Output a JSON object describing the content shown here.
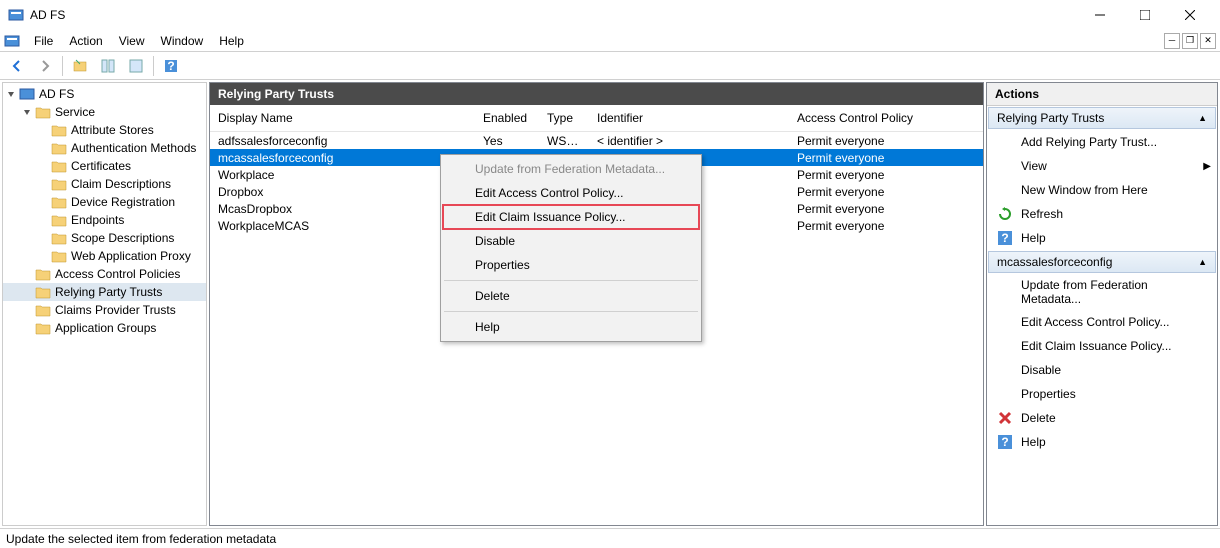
{
  "window": {
    "title": "AD FS"
  },
  "menubar": [
    "File",
    "Action",
    "View",
    "Window",
    "Help"
  ],
  "tree": {
    "root": "AD FS",
    "service": "Service",
    "service_children": [
      "Attribute Stores",
      "Authentication Methods",
      "Certificates",
      "Claim Descriptions",
      "Device Registration",
      "Endpoints",
      "Scope Descriptions",
      "Web Application Proxy"
    ],
    "top_children": [
      "Access Control Policies",
      "Relying Party Trusts",
      "Claims Provider Trusts",
      "Application Groups"
    ],
    "selected": "Relying Party Trusts"
  },
  "center": {
    "title": "Relying Party Trusts",
    "columns": {
      "name": "Display Name",
      "enabled": "Enabled",
      "type": "Type",
      "id": "Identifier",
      "acp": "Access Control Policy"
    },
    "rows": [
      {
        "name": "adfssalesforceconfig",
        "enabled": "Yes",
        "type": "WS-T...",
        "id": "< identifier >",
        "acp": "Permit everyone",
        "sel": false
      },
      {
        "name": "mcassalesforceconfig",
        "enabled": "",
        "type": "",
        "id": "",
        "acp": "Permit everyone",
        "sel": true
      },
      {
        "name": "Workplace",
        "enabled": "",
        "type": "",
        "id": "",
        "acp": "Permit everyone",
        "sel": false
      },
      {
        "name": "Dropbox",
        "enabled": "",
        "type": "",
        "id": "",
        "acp": "Permit everyone",
        "sel": false
      },
      {
        "name": "McasDropbox",
        "enabled": "",
        "type": "",
        "id": "",
        "acp": "Permit everyone",
        "sel": false
      },
      {
        "name": "WorkplaceMCAS",
        "enabled": "",
        "type": "",
        "id": "",
        "acp": "Permit everyone",
        "sel": false
      }
    ]
  },
  "contextMenu": [
    {
      "label": "Update from Federation Metadata...",
      "disabled": true
    },
    {
      "label": "Edit Access Control Policy...",
      "disabled": false
    },
    {
      "label": "Edit Claim Issuance Policy...",
      "disabled": false,
      "highlight": true
    },
    {
      "label": "Disable",
      "disabled": false
    },
    {
      "label": "Properties",
      "disabled": false
    },
    {
      "sep": true
    },
    {
      "label": "Delete",
      "disabled": false
    },
    {
      "sep": true
    },
    {
      "label": "Help",
      "disabled": false
    }
  ],
  "actions": {
    "header": "Actions",
    "group1": {
      "title": "Relying Party Trusts",
      "items": [
        {
          "label": "Add Relying Party Trust...",
          "icon": "none"
        },
        {
          "label": "View",
          "icon": "none",
          "sub": true
        },
        {
          "label": "New Window from Here",
          "icon": "none"
        },
        {
          "label": "Refresh",
          "icon": "refresh"
        },
        {
          "label": "Help",
          "icon": "help"
        }
      ]
    },
    "group2": {
      "title": "mcassalesforceconfig",
      "items": [
        {
          "label": "Update from Federation Metadata...",
          "icon": "none"
        },
        {
          "label": "Edit Access Control Policy...",
          "icon": "none"
        },
        {
          "label": "Edit Claim Issuance Policy...",
          "icon": "none"
        },
        {
          "label": "Disable",
          "icon": "none"
        },
        {
          "label": "Properties",
          "icon": "none"
        },
        {
          "label": "Delete",
          "icon": "delete"
        },
        {
          "label": "Help",
          "icon": "help"
        }
      ]
    }
  },
  "status": "Update the selected item from federation metadata"
}
